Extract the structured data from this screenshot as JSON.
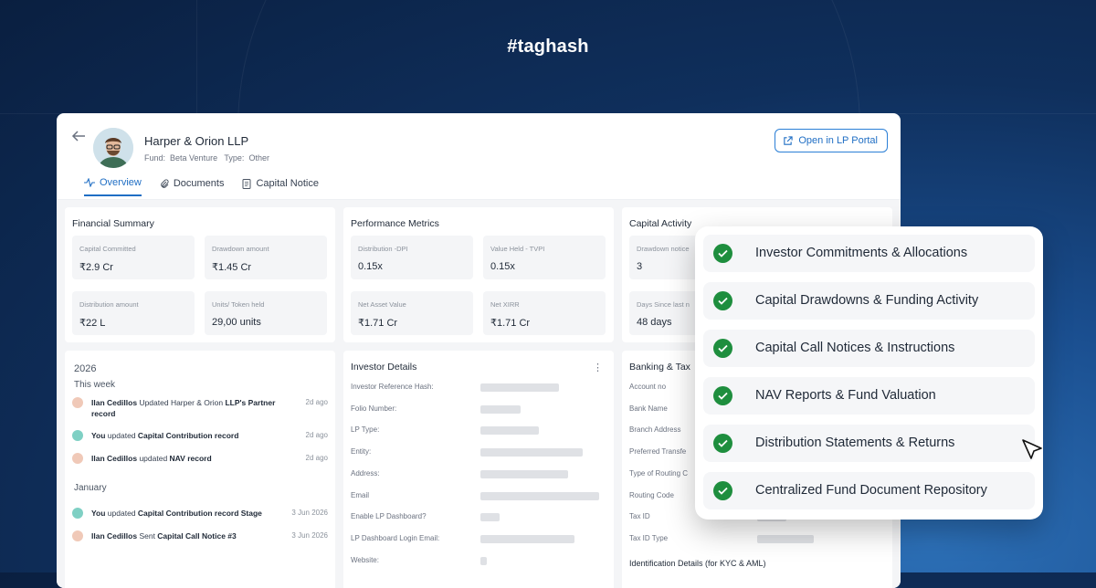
{
  "brand": "#taghash",
  "header": {
    "lp_name": "Harper & Orion LLP",
    "fund_label": "Fund:",
    "fund_value": "Beta Venture",
    "type_label": "Type:",
    "type_value": "Other",
    "portal_button": "Open in LP Portal"
  },
  "tabs": [
    {
      "label": "Overview",
      "icon": "activity-icon",
      "active": true
    },
    {
      "label": "Documents",
      "icon": "paperclip-icon",
      "active": false
    },
    {
      "label": "Capital Notice",
      "icon": "document-icon",
      "active": false
    }
  ],
  "financial_summary": {
    "title": "Financial Summary",
    "metrics": [
      {
        "label": "Capital Committed",
        "value": "₹2.9 Cr"
      },
      {
        "label": "Drawdown amount",
        "value": "₹1.45 Cr"
      },
      {
        "label": "Distribution amount",
        "value": "₹22 L"
      },
      {
        "label": "Units/ Token held",
        "value": "29,00 units"
      }
    ]
  },
  "performance_metrics": {
    "title": "Performance Metrics",
    "metrics": [
      {
        "label": "Distribution -DPI",
        "value": "0.15x"
      },
      {
        "label": "Value  Held - TVPI",
        "value": "0.15x"
      },
      {
        "label": "Net Asset Value",
        "value": "₹1.71 Cr"
      },
      {
        "label": "Net XIRR",
        "value": "₹1.71 Cr"
      }
    ]
  },
  "capital_activity": {
    "title": "Capital Activity",
    "metrics": [
      {
        "label": "Drawdown notice",
        "value": "3"
      },
      {
        "label": "Days Since last n",
        "value": "48 days"
      }
    ]
  },
  "activity": {
    "year": "2026",
    "this_week": "This  week",
    "january": "January",
    "week_items": [
      {
        "user": "Ilan Cedillos",
        "action": " Updated Harper & Orion ",
        "target": "LLP's Partner record",
        "date": "2d ago"
      },
      {
        "user": "You",
        "action": " updated ",
        "target": "Capital Contribution record",
        "date": "2d ago"
      },
      {
        "user": "Ilan Cedillos",
        "action": "  updated ",
        "target": "NAV record",
        "date": "2d ago"
      }
    ],
    "jan_items": [
      {
        "user": "You",
        "action": " updated ",
        "target": "Capital Contribution record Stage",
        "date": "3 Jun 2026"
      },
      {
        "user": "Ilan Cedillos",
        "action": " Sent ",
        "target": "Capital Call Notice #3",
        "date": "3 Jun 2026"
      }
    ]
  },
  "investor_details": {
    "title": "Investor Details",
    "more_icon": "more-vertical-icon",
    "fields": [
      {
        "label": "Investor Reference Hash:",
        "bar": 0.66
      },
      {
        "label": "Folio Number:",
        "bar": 0.34
      },
      {
        "label": "LP Type:",
        "bar": 0.49
      },
      {
        "label": "Entity:",
        "bar": 0.86
      },
      {
        "label": "Address:",
        "bar": 0.74
      },
      {
        "label": "Email",
        "bar": 1.0
      },
      {
        "label": "Enable LP Dashboard?",
        "bar": 0.16
      },
      {
        "label": "LP Dashboard Login Email:",
        "bar": 0.79
      },
      {
        "label": "Website:",
        "bar": 0.05
      }
    ]
  },
  "banking": {
    "title": "Banking & Tax",
    "fields": [
      "Account no",
      "Bank Name",
      "Branch Address",
      "Preferred Transfe",
      "Type of Routing C",
      "Routing Code",
      "Tax ID",
      "Tax ID Type"
    ],
    "footer": "Identification Details (for KYC & AML)"
  },
  "checklist": [
    "Investor Commitments & Allocations",
    "Capital Drawdowns & Funding Activity",
    "Capital Call Notices & Instructions",
    "NAV Reports & Fund Valuation",
    "Distribution Statements & Returns",
    "Centralized Fund Document Repository"
  ],
  "colors": {
    "accent": "#1f6ec4",
    "check": "#1e8e3e"
  }
}
